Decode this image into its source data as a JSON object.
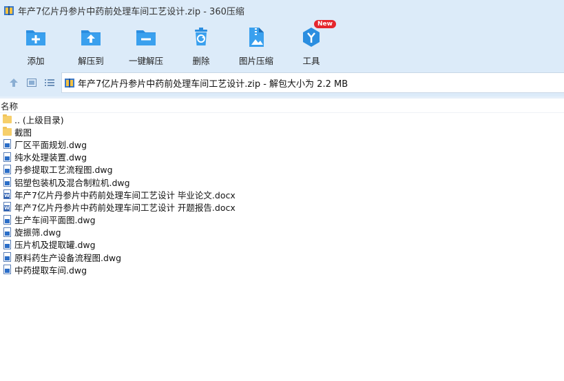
{
  "window": {
    "title": "年产7亿片丹参片中药前处理车间工艺设计.zip - 360压缩"
  },
  "toolbar": {
    "buttons": [
      {
        "label": "添加",
        "icon": "add-icon"
      },
      {
        "label": "解压到",
        "icon": "extract-to-icon"
      },
      {
        "label": "一键解压",
        "icon": "one-click-extract-icon"
      },
      {
        "label": "删除",
        "icon": "delete-icon"
      },
      {
        "label": "图片压缩",
        "icon": "image-compress-icon"
      },
      {
        "label": "工具",
        "icon": "tools-icon"
      }
    ],
    "new_badge": "New"
  },
  "navbar": {
    "path_text": "年产7亿片丹参片中药前处理车间工艺设计.zip - 解包大小为 2.2 MB"
  },
  "filelist": {
    "column_name": "名称",
    "items": [
      {
        "name": ".. (上级目录)",
        "type": "folder"
      },
      {
        "name": "截图",
        "type": "folder"
      },
      {
        "name": "厂区平面规划.dwg",
        "type": "dwg"
      },
      {
        "name": "纯水处理装置.dwg",
        "type": "dwg"
      },
      {
        "name": "丹参提取工艺流程图.dwg",
        "type": "dwg"
      },
      {
        "name": "铝塑包装机及混合制粒机.dwg",
        "type": "dwg"
      },
      {
        "name": "年产7亿片丹参片中药前处理车间工艺设计 毕业论文.docx",
        "type": "docx"
      },
      {
        "name": "年产7亿片丹参片中药前处理车间工艺设计 开题报告.docx",
        "type": "docx"
      },
      {
        "name": "生产车间平面图.dwg",
        "type": "dwg"
      },
      {
        "name": "旋振筛.dwg",
        "type": "dwg"
      },
      {
        "name": "压片机及提取罐.dwg",
        "type": "dwg"
      },
      {
        "name": "原料药生产设备流程图.dwg",
        "type": "dwg"
      },
      {
        "name": "中药提取车间.dwg",
        "type": "dwg"
      }
    ]
  },
  "colors": {
    "toolbar_bg": "#dcebf9",
    "icon_blue": "#2b8ee0",
    "badge_red": "#e5262d"
  }
}
